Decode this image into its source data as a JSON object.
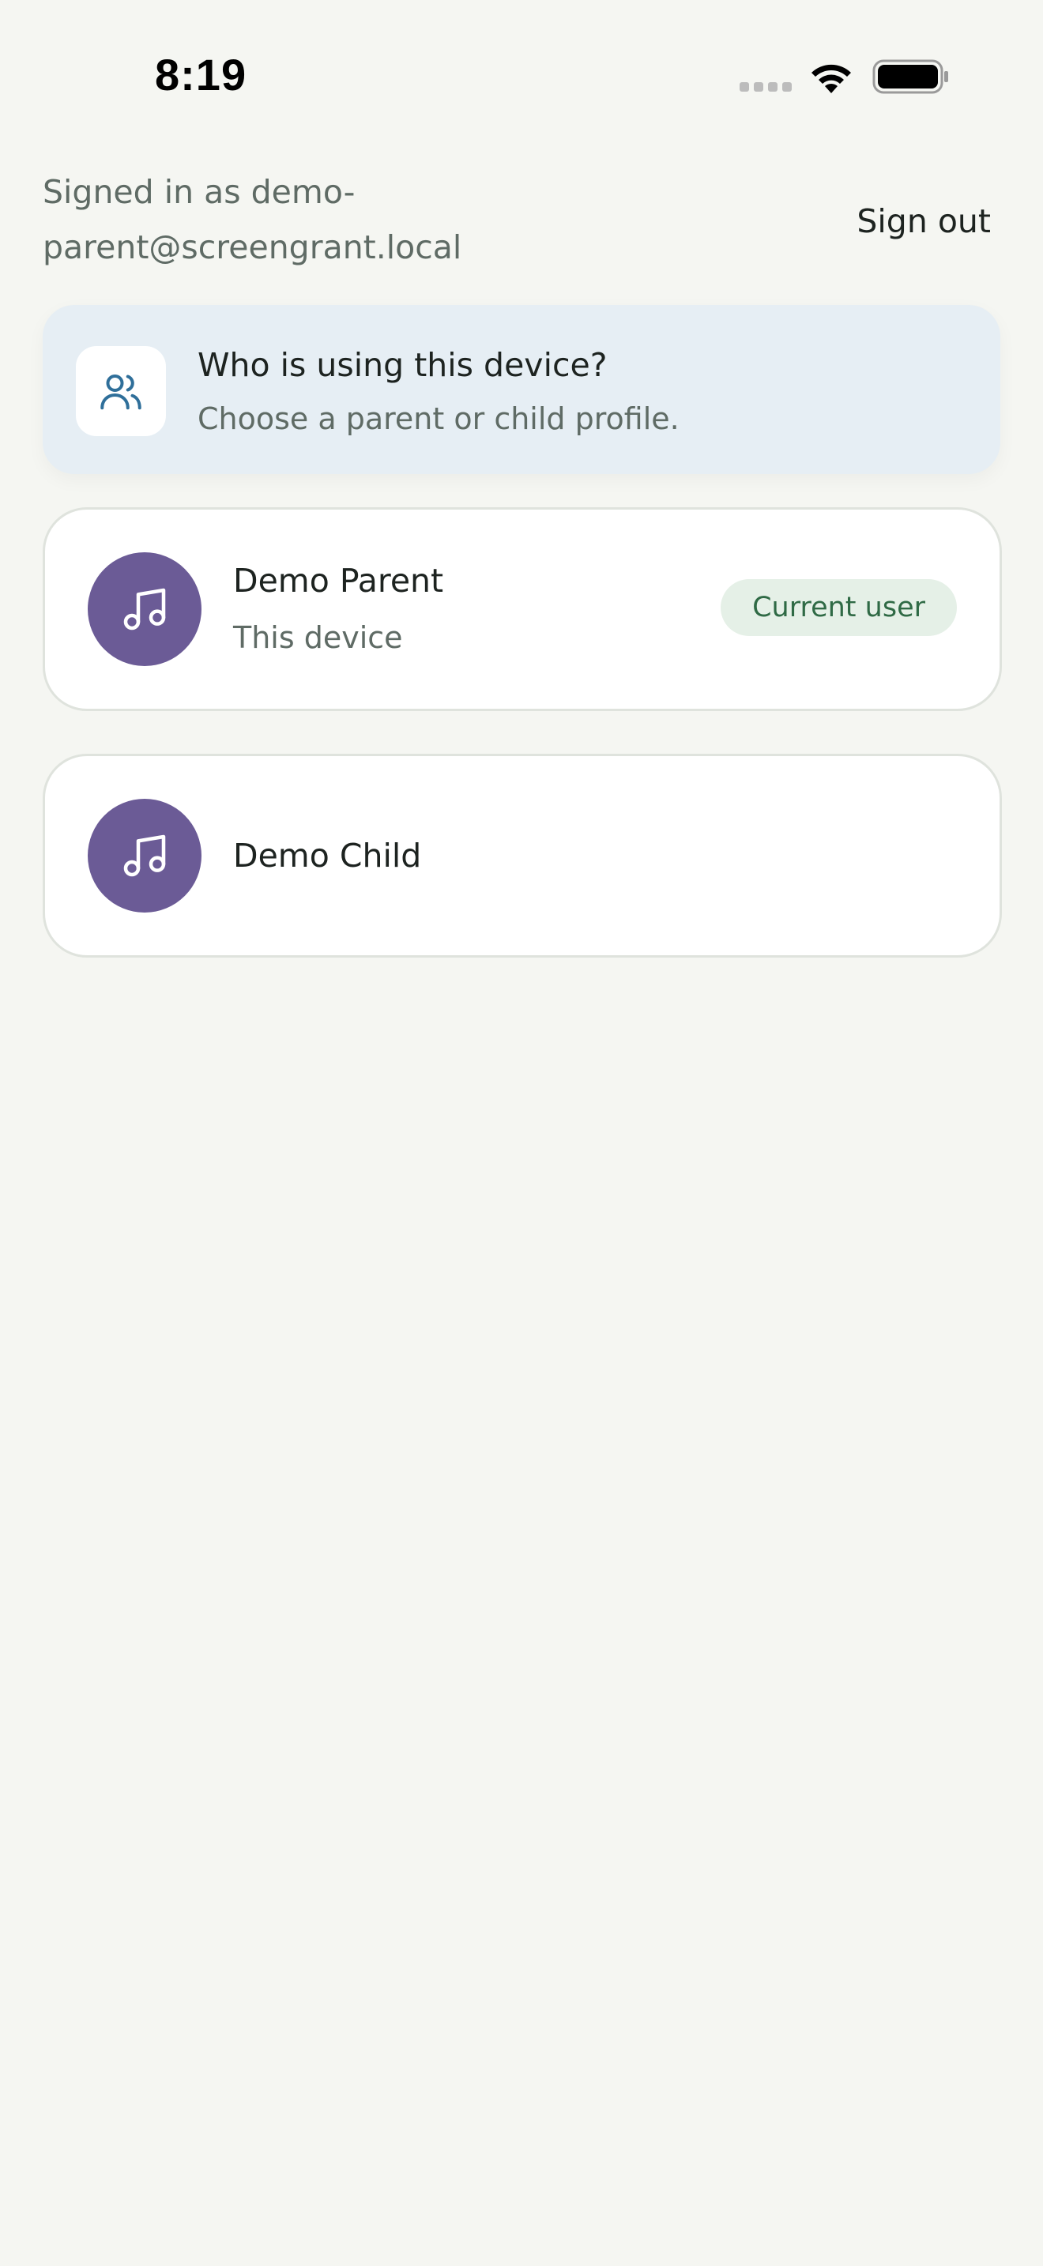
{
  "status_bar": {
    "time": "8:19"
  },
  "header": {
    "signed_in_text": "Signed in as demo-parent@screengrant.local",
    "sign_out_label": "Sign out"
  },
  "prompt": {
    "icon": "users-icon",
    "title": "Who is using this device?",
    "subtitle": "Choose a parent or child profile."
  },
  "profiles": [
    {
      "icon": "music-note-icon",
      "name": "Demo Parent",
      "subtitle": "This device",
      "badge": "Current user"
    },
    {
      "icon": "music-note-icon",
      "name": "Demo Child"
    }
  ],
  "colors": {
    "background": "#f5f6f2",
    "avatar": "#6b5b96",
    "prompt_card": "#e6eef4",
    "badge_bg": "#e5f0e7",
    "badge_text": "#2f6a45",
    "icon_accent": "#2f6f9a"
  }
}
